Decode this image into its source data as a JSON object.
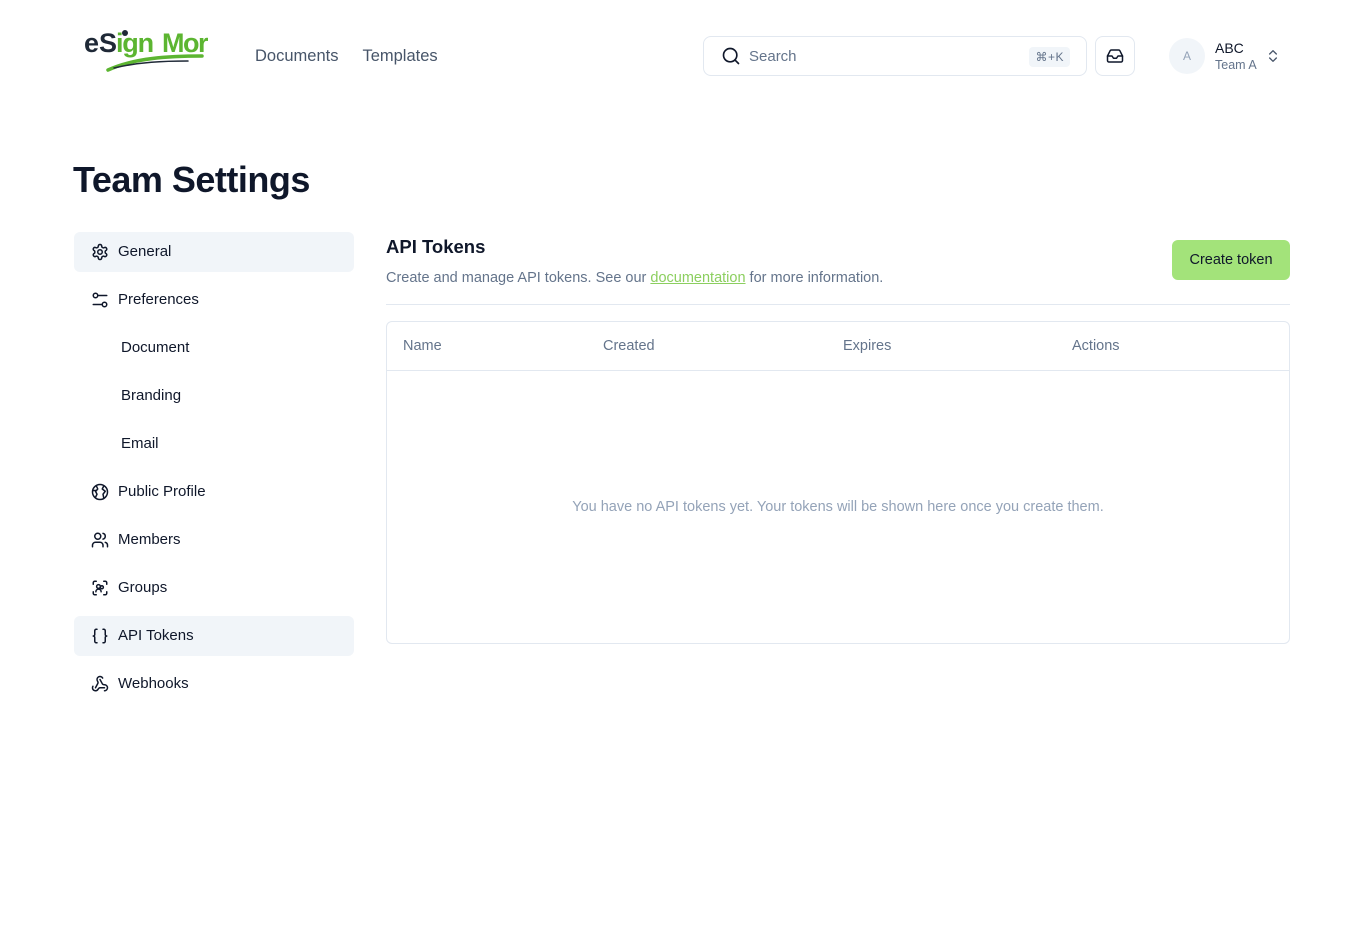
{
  "brand": {
    "logo_text": "eSignMor",
    "accent": "#a3e37a",
    "logo_green": "#5cb531"
  },
  "nav": {
    "documents": "Documents",
    "templates": "Templates"
  },
  "search": {
    "placeholder": "Search",
    "shortcut": "⌘+K"
  },
  "user": {
    "initial": "A",
    "name": "ABC",
    "team": "Team A"
  },
  "page": {
    "title": "Team Settings"
  },
  "sidebar": {
    "items": [
      {
        "label": "General",
        "icon": "gear-icon"
      },
      {
        "label": "Preferences",
        "icon": "sliders-icon"
      },
      {
        "label": "Document"
      },
      {
        "label": "Branding"
      },
      {
        "label": "Email"
      },
      {
        "label": "Public Profile",
        "icon": "globe-icon"
      },
      {
        "label": "Members",
        "icon": "users-icon"
      },
      {
        "label": "Groups",
        "icon": "group-scan-icon"
      },
      {
        "label": "API Tokens",
        "icon": "braces-icon"
      },
      {
        "label": "Webhooks",
        "icon": "webhook-icon"
      }
    ]
  },
  "main": {
    "title": "API Tokens",
    "desc_before": "Create and manage API tokens. See our ",
    "desc_link": "documentation",
    "desc_after": " for more information.",
    "create_label": "Create token",
    "table": {
      "columns": [
        "Name",
        "Created",
        "Expires",
        "Actions"
      ],
      "empty": "You have no API tokens yet. Your tokens will be shown here once you create them."
    }
  }
}
